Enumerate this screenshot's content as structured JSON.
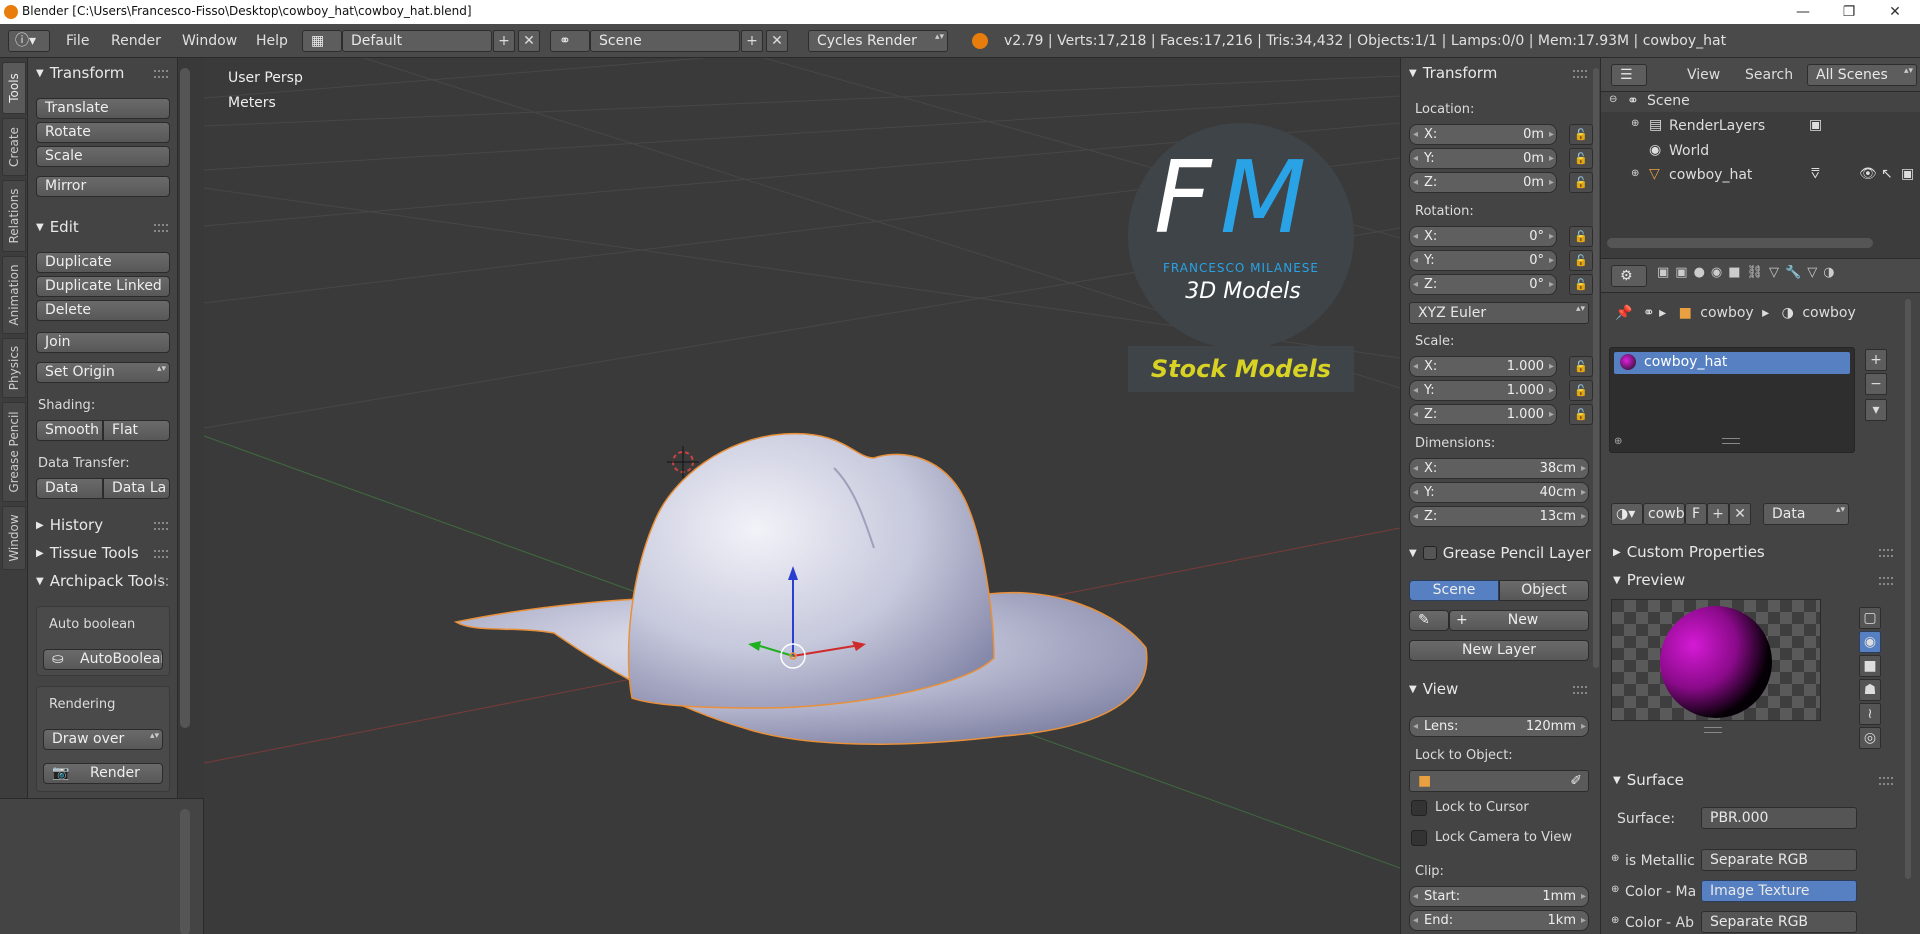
{
  "window": {
    "title": "Blender [C:\\Users\\Francesco-Fisso\\Desktop\\cowboy_hat\\cowboy_hat.blend]",
    "minimize": "—",
    "maximize": "❐",
    "close": "✕"
  },
  "menu": {
    "file": "File",
    "render": "Render",
    "window": "Window",
    "help": "Help"
  },
  "header": {
    "layout": "Default",
    "scene": "Scene",
    "engine": "Cycles Render",
    "stats": "v2.79 | Verts:17,218 | Faces:17,216 | Tris:34,432 | Objects:1/1 | Lamps:0/0 | Mem:17.93M | cowboy_hat"
  },
  "vtabs": [
    "Tools",
    "Create",
    "Relations",
    "Animation",
    "Physics",
    "Grease Pencil",
    "Window"
  ],
  "tools": {
    "transform": "Transform",
    "translate": "Translate",
    "rotate": "Rotate",
    "scale": "Scale",
    "mirror": "Mirror",
    "edit": "Edit",
    "duplicate": "Duplicate",
    "duplicate_linked": "Duplicate Linked",
    "delete": "Delete",
    "join": "Join",
    "set_origin": "Set Origin",
    "shading": "Shading:",
    "smooth": "Smooth",
    "flat": "Flat",
    "data_transfer": "Data Transfer:",
    "data": "Data",
    "data_la": "Data La",
    "history": "History",
    "tissue": "Tissue Tools",
    "archipack": "Archipack Tools",
    "auto_boolean_lbl": "Auto boolean",
    "auto_boolean_btn": "AutoBoolean",
    "rendering": "Rendering",
    "draw_over": "Draw over",
    "render": "Render"
  },
  "viewport": {
    "persp": "User Persp",
    "units": "Meters"
  },
  "logo": {
    "letters_f": "F",
    "letters_m": "M",
    "company": "FRANCESCO MILANESE",
    "models": "3D Models",
    "stock": "Stock Models"
  },
  "npanel": {
    "transform": "Transform",
    "location": "Location:",
    "loc": [
      {
        "k": "X:",
        "v": "0m"
      },
      {
        "k": "Y:",
        "v": "0m"
      },
      {
        "k": "Z:",
        "v": "0m"
      }
    ],
    "rotation": "Rotation:",
    "rot": [
      {
        "k": "X:",
        "v": "0°"
      },
      {
        "k": "Y:",
        "v": "0°"
      },
      {
        "k": "Z:",
        "v": "0°"
      }
    ],
    "euler": "XYZ Euler",
    "scale": "Scale:",
    "scl": [
      {
        "k": "X:",
        "v": "1.000"
      },
      {
        "k": "Y:",
        "v": "1.000"
      },
      {
        "k": "Z:",
        "v": "1.000"
      }
    ],
    "dimensions": "Dimensions:",
    "dim": [
      {
        "k": "X:",
        "v": "38cm"
      },
      {
        "k": "Y:",
        "v": "40cm"
      },
      {
        "k": "Z:",
        "v": "13cm"
      }
    ],
    "gp_layer": "Grease Pencil Layer",
    "scene_btn": "Scene",
    "object_btn": "Object",
    "new": "New",
    "new_layer": "New Layer",
    "view": "View",
    "lens_k": "Lens:",
    "lens_v": "120mm",
    "lock_obj": "Lock to Object:",
    "lock_cursor": "Lock to Cursor",
    "lock_camera": "Lock Camera to View",
    "clip": "Clip:",
    "start_k": "Start:",
    "start_v": "1mm",
    "end_k": "End:",
    "end_v": "1km"
  },
  "outliner": {
    "view": "View",
    "search": "Search",
    "scope": "All Scenes",
    "scene": "Scene",
    "renderlayers": "RenderLayers",
    "world": "World",
    "object": "cowboy_hat"
  },
  "props": {
    "crumb1": "cowboy",
    "crumb2": "cowboy",
    "slot": "cowboy_hat",
    "mat_name": "cowb",
    "f": "F",
    "data": "Data",
    "custom": "Custom Properties",
    "preview": "Preview",
    "surface": "Surface",
    "surface_k": "Surface:",
    "surface_v": "PBR.000",
    "rows": [
      {
        "k": "is Metallic",
        "v": "Separate RGB"
      },
      {
        "k": "Color - Ma",
        "v": "Image Texture"
      },
      {
        "k": "Color - Ab",
        "v": "Separate RGB"
      }
    ]
  }
}
